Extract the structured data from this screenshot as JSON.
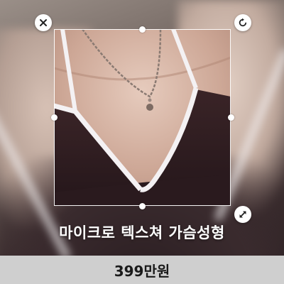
{
  "editor": {
    "close_icon": "close-icon",
    "rotate_icon": "rotate-icon",
    "resize_icon": "resize-icon"
  },
  "product": {
    "title": "마이크로 텍스쳐 가슴성형",
    "price": "399만원"
  },
  "colors": {
    "price_bar": "#cfcfcf",
    "title_text": "#ffffff",
    "frame": "#ffffff"
  }
}
